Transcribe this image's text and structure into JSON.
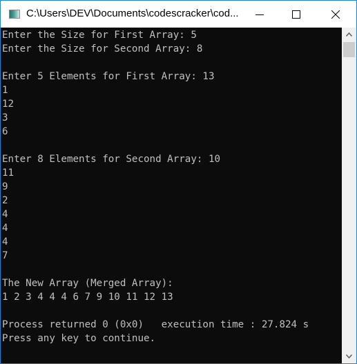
{
  "window": {
    "title": "C:\\Users\\DEV\\Documents\\codescracker\\cod...",
    "icon": "console-app-icon",
    "controls": {
      "minimize": "minimize-icon",
      "maximize": "maximize-icon",
      "close": "close-icon"
    }
  },
  "console": {
    "lines": [
      "Enter the Size for First Array: 5",
      "Enter the Size for Second Array: 8",
      "",
      "Enter 5 Elements for First Array: 13",
      "1",
      "12",
      "3",
      "6",
      "",
      "Enter 8 Elements for Second Array: 10",
      "11",
      "9",
      "2",
      "4",
      "4",
      "4",
      "7",
      "",
      "The New Array (Merged Array):",
      "1 2 3 4 4 4 6 7 9 10 11 12 13",
      "",
      "Process returned 0 (0x0)   execution time : 27.824 s",
      "Press any key to continue."
    ]
  },
  "scrollbar": {
    "up": "chevron-up-icon",
    "down": "chevron-down-icon"
  }
}
